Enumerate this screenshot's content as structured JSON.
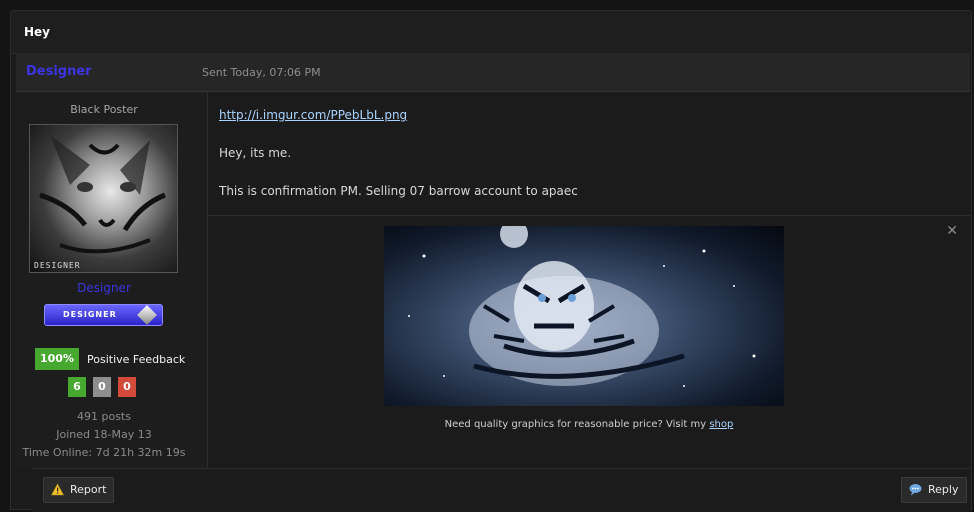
{
  "thread": {
    "title": "Hey"
  },
  "post": {
    "author": "Designer",
    "sent": "Sent Today, 07:06 PM",
    "link": "http://i.imgur.com/PPebLbL.png",
    "line1": "Hey, its me.",
    "line2": "This is confirmation PM. Selling 07 barrow account to apaec"
  },
  "user": {
    "title": "Black Poster",
    "avatar_label": "DESIGNER",
    "name": "Designer",
    "rank_label": "DESIGNER",
    "feedback_pct": "100%",
    "feedback_label": "Positive Feedback",
    "pos": "6",
    "neu": "0",
    "neg": "0",
    "posts": "491 posts",
    "joined": "Joined 18-May 13",
    "time_online": "Time Online: 7d 21h 32m 19s"
  },
  "signature": {
    "text": "Need quality graphics for reasonable price? Visit my",
    "link": "shop",
    "close": "✕"
  },
  "buttons": {
    "report": "Report",
    "reply": "Reply"
  },
  "icons": {
    "report": "warning-icon",
    "reply": "speech-bubble-icon",
    "sig_close": "close-icon"
  }
}
